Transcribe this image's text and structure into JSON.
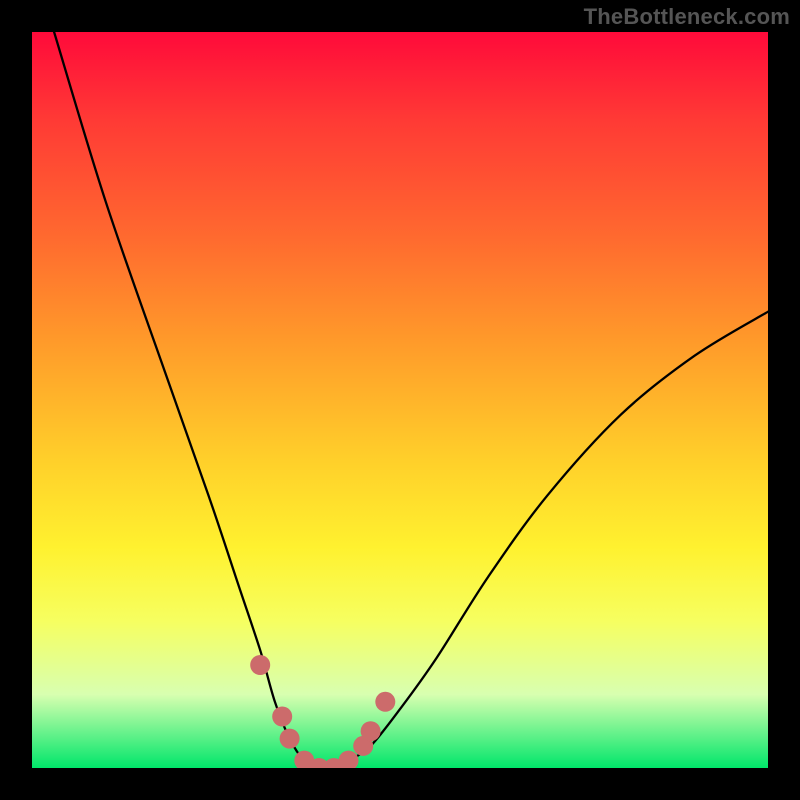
{
  "watermark": "TheBottleneck.com",
  "chart_data": {
    "type": "line",
    "title": "",
    "xlabel": "",
    "ylabel": "",
    "xlim": [
      0,
      100
    ],
    "ylim": [
      0,
      100
    ],
    "grid": false,
    "legend": false,
    "series": [
      {
        "name": "curve",
        "x": [
          3,
          10,
          18,
          24,
          28,
          31,
          33,
          35,
          37,
          39,
          41,
          43,
          46,
          50,
          55,
          62,
          70,
          80,
          90,
          100
        ],
        "values": [
          100,
          77,
          54,
          37,
          25,
          16,
          9,
          4,
          1,
          0,
          0,
          1,
          3,
          8,
          15,
          26,
          37,
          48,
          56,
          62
        ]
      }
    ],
    "markers": [
      {
        "x": 31,
        "y": 14
      },
      {
        "x": 34,
        "y": 7
      },
      {
        "x": 35,
        "y": 4
      },
      {
        "x": 37,
        "y": 1
      },
      {
        "x": 39,
        "y": 0
      },
      {
        "x": 41,
        "y": 0
      },
      {
        "x": 43,
        "y": 1
      },
      {
        "x": 45,
        "y": 3
      },
      {
        "x": 46,
        "y": 5
      },
      {
        "x": 48,
        "y": 9
      }
    ],
    "gradient_stops": [
      {
        "pos": 0,
        "color": "#ff0a3a"
      },
      {
        "pos": 28,
        "color": "#ff6a2f"
      },
      {
        "pos": 58,
        "color": "#ffcf2a"
      },
      {
        "pos": 80,
        "color": "#f6ff60"
      },
      {
        "pos": 100,
        "color": "#00e66a"
      }
    ]
  }
}
